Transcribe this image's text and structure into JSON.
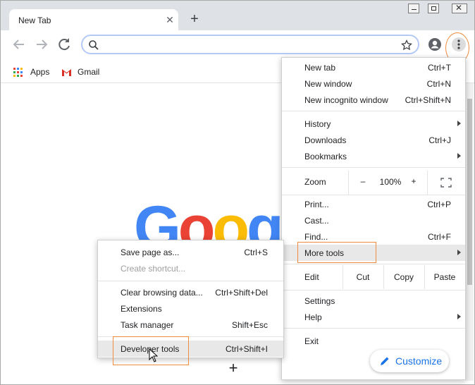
{
  "tab": {
    "title": "New Tab"
  },
  "bookmarks": [
    {
      "label": "Apps",
      "icon": "apps-grid-icon"
    },
    {
      "label": "Gmail",
      "icon": "gmail-icon"
    }
  ],
  "logo": {
    "letters": [
      "G",
      "o",
      "o",
      "g"
    ],
    "colors": [
      "#4285f4",
      "#ea4335",
      "#fbbc05",
      "#4285f4"
    ]
  },
  "main_menu": {
    "new_tab": {
      "label": "New tab",
      "shortcut": "Ctrl+T"
    },
    "new_window": {
      "label": "New window",
      "shortcut": "Ctrl+N"
    },
    "new_incognito": {
      "label": "New incognito window",
      "shortcut": "Ctrl+Shift+N"
    },
    "history": {
      "label": "History"
    },
    "downloads": {
      "label": "Downloads",
      "shortcut": "Ctrl+J"
    },
    "bookmarks": {
      "label": "Bookmarks"
    },
    "zoom": {
      "label": "Zoom",
      "minus": "–",
      "value": "100%",
      "plus": "+"
    },
    "print": {
      "label": "Print...",
      "shortcut": "Ctrl+P"
    },
    "cast": {
      "label": "Cast..."
    },
    "find": {
      "label": "Find...",
      "shortcut": "Ctrl+F"
    },
    "more_tools": {
      "label": "More tools"
    },
    "edit": {
      "label": "Edit",
      "cut": "Cut",
      "copy": "Copy",
      "paste": "Paste"
    },
    "settings": {
      "label": "Settings"
    },
    "help": {
      "label": "Help"
    },
    "exit": {
      "label": "Exit"
    }
  },
  "sub_menu": {
    "save_page": {
      "label": "Save page as...",
      "shortcut": "Ctrl+S"
    },
    "create_shortcut": {
      "label": "Create shortcut..."
    },
    "clear_browsing": {
      "label": "Clear browsing data...",
      "shortcut": "Ctrl+Shift+Del"
    },
    "extensions": {
      "label": "Extensions"
    },
    "task_manager": {
      "label": "Task manager",
      "shortcut": "Shift+Esc"
    },
    "developer_tools": {
      "label": "Developer tools",
      "shortcut": "Ctrl+Shift+I"
    }
  },
  "customize": {
    "label": "Customize"
  },
  "colors": {
    "accent": "#1a73e8",
    "highlight_box": "#f08b3d"
  }
}
